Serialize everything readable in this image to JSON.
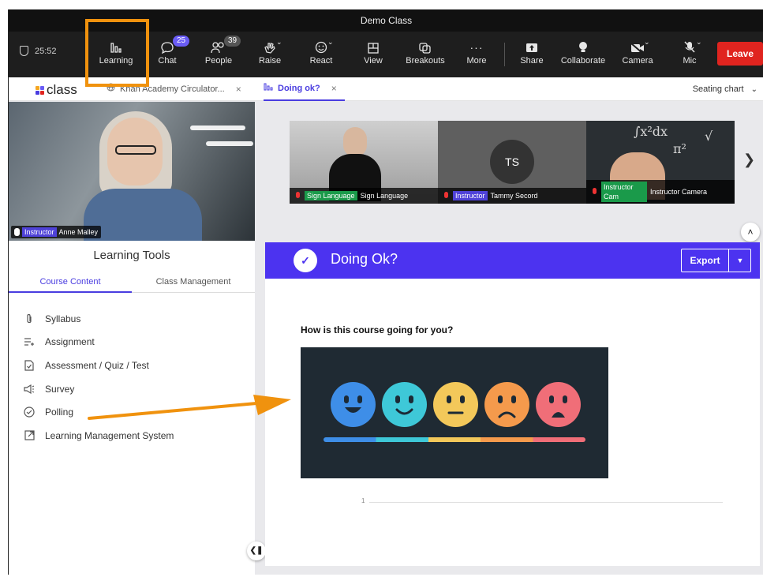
{
  "window": {
    "title": "Demo Class"
  },
  "toolbar": {
    "timer": "25:52",
    "buttons": [
      {
        "label": "Learning"
      },
      {
        "label": "Chat",
        "badge": "25"
      },
      {
        "label": "People",
        "badge": "39"
      },
      {
        "label": "Raise"
      },
      {
        "label": "React"
      },
      {
        "label": "View"
      },
      {
        "label": "Breakouts"
      },
      {
        "label": "More"
      },
      {
        "label": "Share"
      },
      {
        "label": "Collaborate"
      },
      {
        "label": "Camera"
      },
      {
        "label": "Mic"
      }
    ],
    "leave_label": "Leave",
    "leave_color": "#e0241f",
    "highlight_color": "#f0920e"
  },
  "tabs": {
    "logo_text": "class",
    "items": [
      {
        "label": "Khan Academy Circulator...",
        "close": "×"
      },
      {
        "label": "Doing ok?",
        "close": "×"
      }
    ],
    "seating_label": "Seating chart"
  },
  "main_video": {
    "role": "Instructor",
    "name": "Anne Malley"
  },
  "learning_tools": {
    "title": "Learning Tools",
    "tabs": [
      {
        "label": "Course Content"
      },
      {
        "label": "Class Management"
      }
    ],
    "items": [
      {
        "label": "Syllabus",
        "icon": "paperclip-icon"
      },
      {
        "label": "Assignment",
        "icon": "assignment-icon"
      },
      {
        "label": "Assessment / Quiz / Test",
        "icon": "assessment-icon"
      },
      {
        "label": "Survey",
        "icon": "megaphone-icon"
      },
      {
        "label": "Polling",
        "icon": "check-circle-icon"
      },
      {
        "label": "Learning Management System",
        "icon": "external-link-icon"
      }
    ]
  },
  "strip": {
    "tiles": [
      {
        "role": "Sign Language",
        "name": "Sign Language",
        "role_color": "#1a9a4a"
      },
      {
        "initials": "TS",
        "role": "Instructor",
        "name": "Tammy Secord",
        "role_color": "#4f42d8"
      },
      {
        "role": "Instructor Cam",
        "name": "Instructor Camera",
        "role_color": "#1a9a4a"
      }
    ]
  },
  "poll": {
    "title": "Doing Ok?",
    "export_label": "Export",
    "question": "How is this course going for you?",
    "axis_tick": "1",
    "header_color": "#4c33f0",
    "emoji_colors": [
      "#3e8ee8",
      "#3ec8d8",
      "#f3c85a",
      "#f59a4c",
      "#f06e78"
    ]
  }
}
